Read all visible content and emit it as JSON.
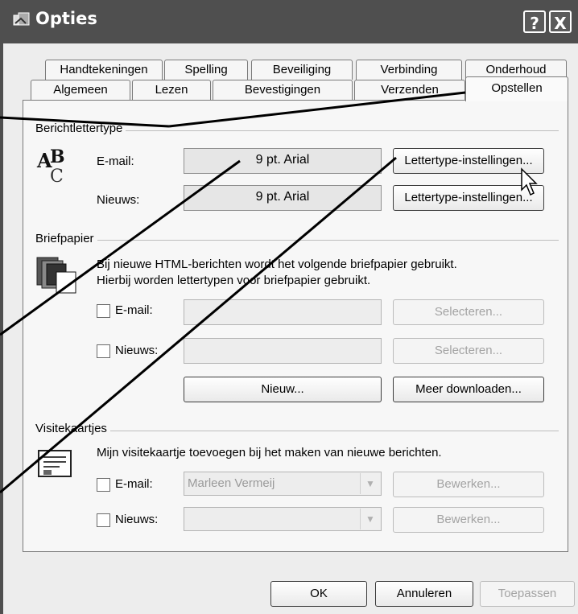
{
  "window": {
    "title": "Opties"
  },
  "titlebar_buttons": {
    "help": "?",
    "close": "X"
  },
  "tabs_row1": [
    "Handtekeningen",
    "Spelling",
    "Beveiliging",
    "Verbinding",
    "Onderhoud"
  ],
  "tabs_row2": [
    "Algemeen",
    "Lezen",
    "Bevestigingen",
    "Verzenden",
    "Opstellen"
  ],
  "active_tab": "Opstellen",
  "font_section": {
    "title": "Berichtlettertype",
    "email_label": "E-mail:",
    "email_value": "9 pt. Arial",
    "news_label": "Nieuws:",
    "news_value": "9 pt. Arial",
    "settings_button": "Lettertype-instellingen..."
  },
  "stationery_section": {
    "title": "Briefpapier",
    "description_line1": "Bij nieuwe HTML-berichten wordt het volgende briefpapier gebruikt.",
    "description_line2": "Hierbij worden lettertypen voor briefpapier gebruikt.",
    "email_label": "E-mail:",
    "news_label": "Nieuws:",
    "select_button": "Selecteren...",
    "new_button": "Nieuw...",
    "download_button": "Meer downloaden..."
  },
  "vcard_section": {
    "title": "Visitekaartjes",
    "description": "Mijn visitekaartje toevoegen bij het maken van nieuwe berichten.",
    "email_label": "E-mail:",
    "email_value": "Marleen Vermeij",
    "news_label": "Nieuws:",
    "edit_button": "Bewerken..."
  },
  "footer": {
    "ok": "OK",
    "cancel": "Annuleren",
    "apply": "Toepassen"
  }
}
